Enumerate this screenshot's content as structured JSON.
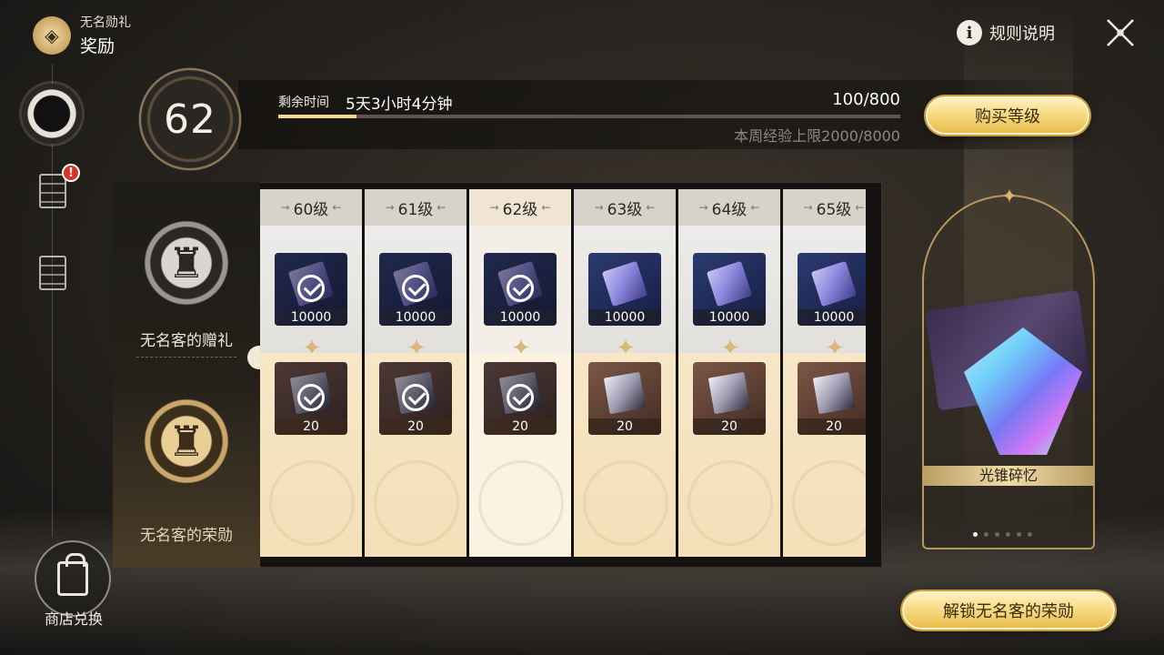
{
  "header": {
    "small_title": "无名勋礼",
    "title": "奖励"
  },
  "rules": {
    "label": "规则说明",
    "icon": "info-icon"
  },
  "rail": {
    "items": [
      {
        "name": "pass-emblem-tab",
        "active": true
      },
      {
        "name": "missions-tab",
        "badge": "!"
      },
      {
        "name": "info-tab"
      }
    ],
    "shop_label": "商店兑换"
  },
  "level": {
    "current": "62",
    "time_label": "剩余时间",
    "time_value": "5天3小时4分钟",
    "exp_value": "100/800",
    "exp_progress": 0.125,
    "weekly_cap": "本周经验上限2000/8000",
    "buy_button": "购买等级"
  },
  "tiers": {
    "free_label": "无名客的赠礼",
    "paid_label": "无名客的荣勋"
  },
  "columns": [
    {
      "level": "60级",
      "free_qty": "10000",
      "paid_qty": "20",
      "claimed": true,
      "current": false
    },
    {
      "level": "61级",
      "free_qty": "10000",
      "paid_qty": "20",
      "claimed": true,
      "current": false
    },
    {
      "level": "62级",
      "free_qty": "10000",
      "paid_qty": "20",
      "claimed": true,
      "current": true
    },
    {
      "level": "63级",
      "free_qty": "10000",
      "paid_qty": "20",
      "claimed": false,
      "current": false
    },
    {
      "level": "64级",
      "free_qty": "10000",
      "paid_qty": "20",
      "claimed": false,
      "current": false
    },
    {
      "level": "65级",
      "free_qty": "10000",
      "paid_qty": "20",
      "claimed": false,
      "current": false
    }
  ],
  "showcase": {
    "label": "光锥碎忆",
    "page_count": 6,
    "active_page": 0
  },
  "unlock_button": "解锁无名客的荣勋",
  "colors": {
    "gold_button": "#f5d67a",
    "badge_red": "#d8322a",
    "progress_fill": "#f4d58e"
  }
}
